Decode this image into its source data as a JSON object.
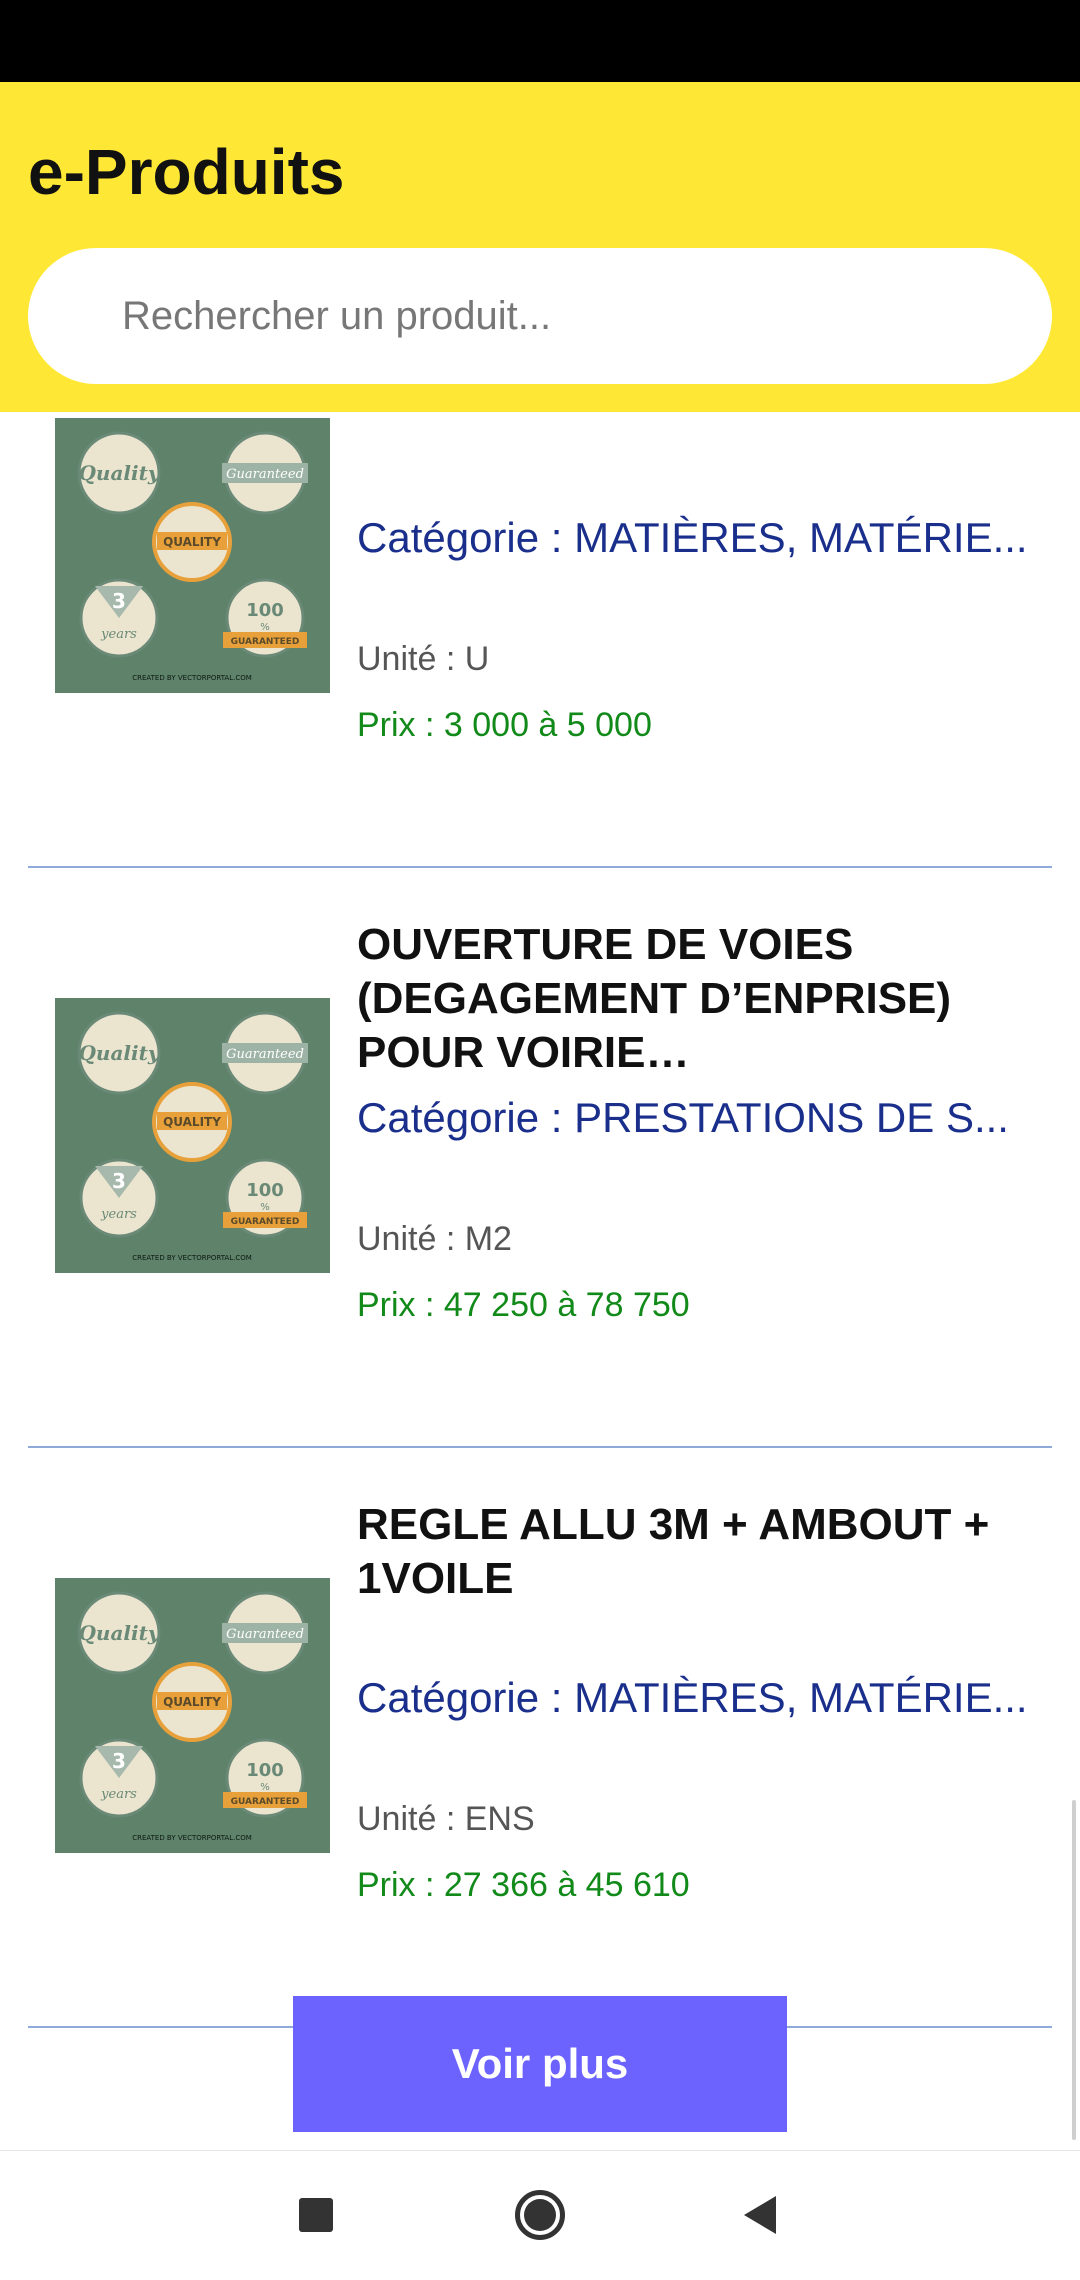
{
  "app": {
    "title": "e-Produits"
  },
  "search": {
    "placeholder": "Rechercher un produit..."
  },
  "products": [
    {
      "name": "…",
      "category": "Catégorie : MATIÈRES, MATÉRIE...",
      "unit": "Unité : U",
      "price": "Prix : 3 000 à 5 000"
    },
    {
      "name": "OUVERTURE DE VOIES (DEGAGEMENT D’ENPRISE) POUR VOIRIE…",
      "category": "Catégorie : PRESTATIONS DE S...",
      "unit": "Unité : M2",
      "price": "Prix : 47 250 à 78 750"
    },
    {
      "name": "REGLE ALLU 3M + AMBOUT + 1VOILE",
      "category": "Catégorie : MATIÈRES, MATÉRIE...",
      "unit": "Unité : ENS",
      "price": "Prix : 27 366 à 45 610"
    }
  ],
  "product_image": {
    "background": "#5e826a",
    "badges": [
      "Quality",
      "Guaranteed",
      "QUALITY",
      "3",
      "years",
      "100",
      "%",
      "GUARANTEED"
    ],
    "footer": "CREATED BY VECTORPORTAL.COM"
  },
  "actions": {
    "voir_plus": "Voir plus"
  },
  "nav": {
    "recent_icon": "square-icon",
    "home_icon": "circle-icon",
    "back_icon": "triangle-back-icon"
  },
  "colors": {
    "header": "#ffe835",
    "category": "#1a2f8c",
    "price": "#128a1a",
    "button": "#6c63ff",
    "divider": "#8fa9d8"
  }
}
